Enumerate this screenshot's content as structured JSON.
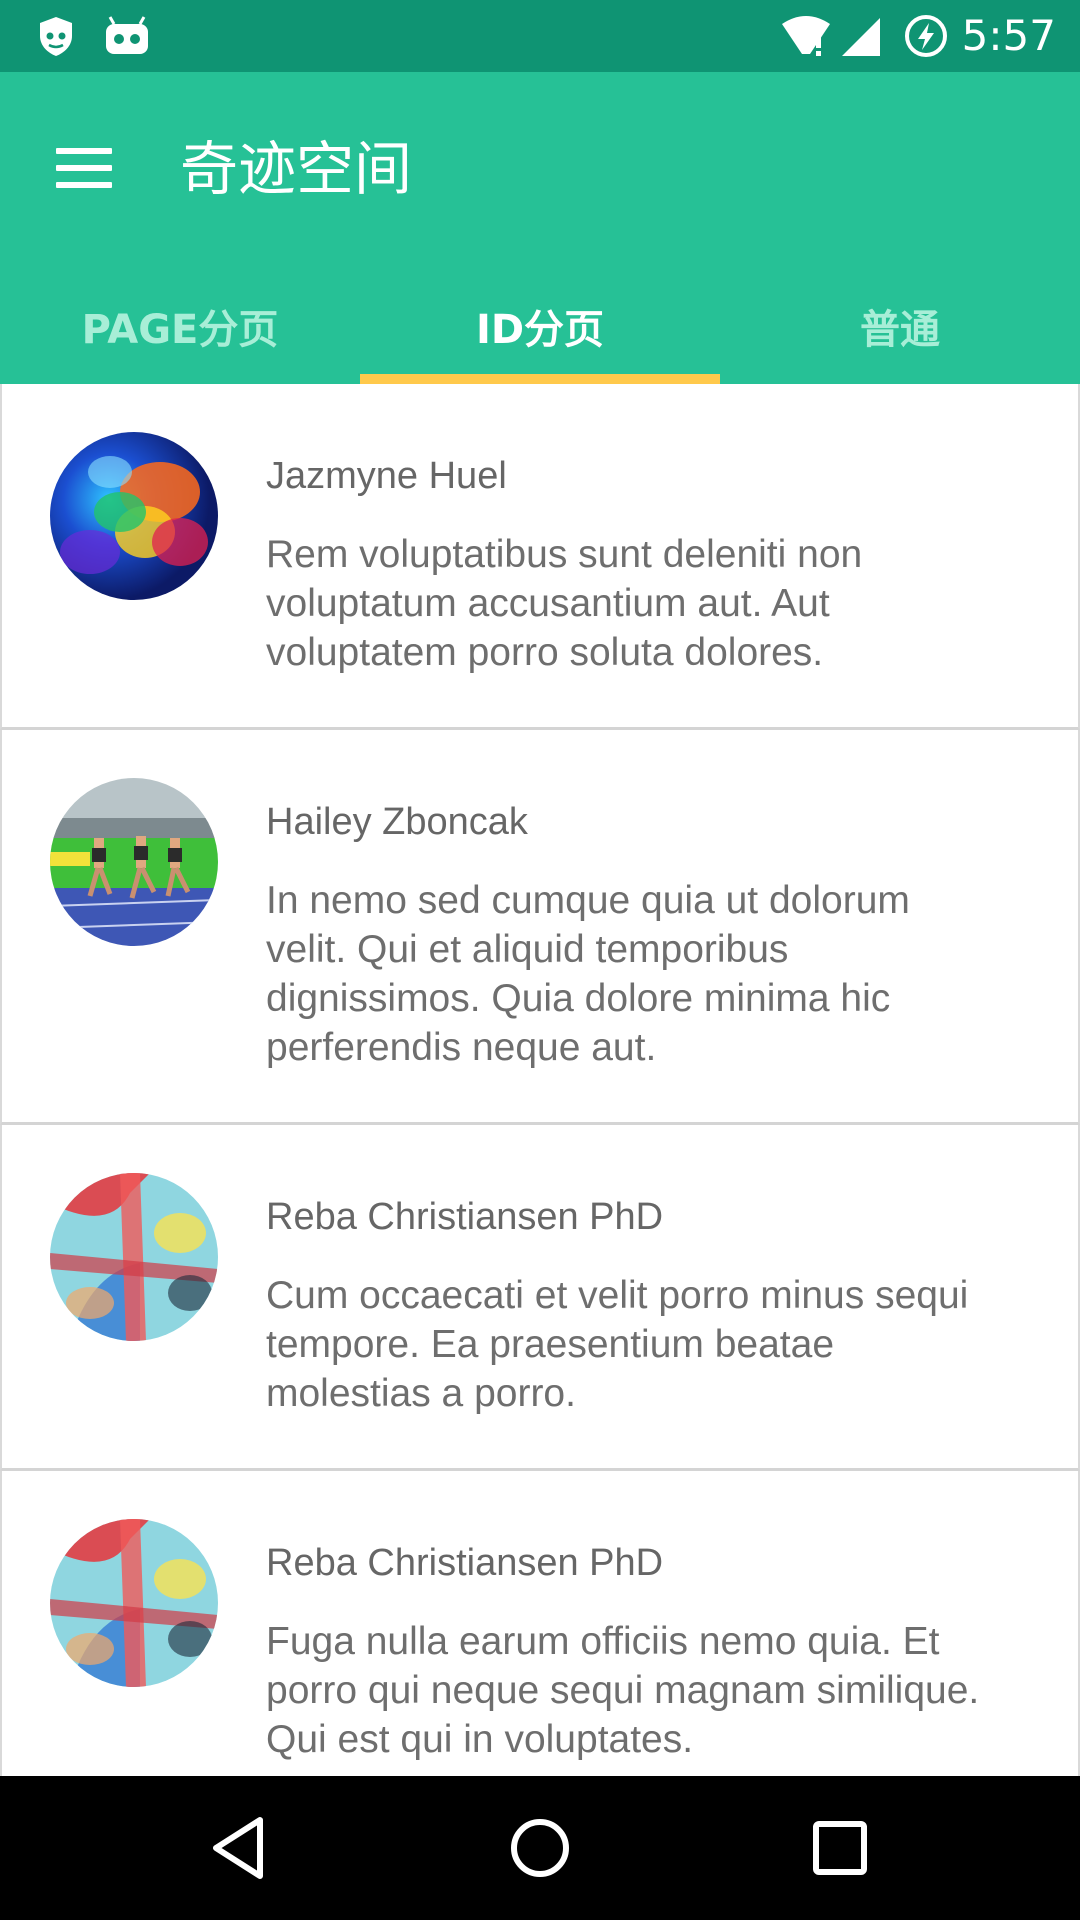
{
  "status_bar": {
    "time": "5:57",
    "icons": [
      "guard-icon",
      "android-debug-icon",
      "wifi-alert-icon",
      "cell-signal-icon",
      "battery-charging-icon"
    ]
  },
  "app_bar": {
    "title": "奇迹空间",
    "menu_icon": "hamburger-menu-icon"
  },
  "tabs": [
    {
      "label": "PAGE分页",
      "active": false
    },
    {
      "label": "ID分页",
      "active": true
    },
    {
      "label": "普通",
      "active": false
    }
  ],
  "list": {
    "items": [
      {
        "name": "Jazmyne Huel",
        "body": "Rem voluptatibus sunt deleniti non voluptatum accusantium aut. Aut voluptatem porro soluta dolores.",
        "avatar": "abstract-color-avatar"
      },
      {
        "name": "Hailey Zboncak",
        "body": "In nemo sed cumque quia ut dolorum velit. Qui et aliquid temporibus dignissimos. Quia dolore minima hic perferendis neque aut.",
        "avatar": "runners-photo-avatar"
      },
      {
        "name": "Reba Christiansen PhD",
        "body": "Cum occaecati et velit porro minus sequi tempore. Ea praesentium beatae molestias a porro.",
        "avatar": "paint-splash-avatar"
      },
      {
        "name": "Reba Christiansen PhD",
        "body": "Fuga nulla earum officiis nemo quia. Et porro qui neque sequi magnam similique. Qui est qui in voluptates.",
        "avatar": "paint-splash-avatar"
      }
    ]
  },
  "nav_bar": {
    "buttons": [
      "back-icon",
      "home-icon",
      "recents-icon"
    ]
  },
  "colors": {
    "status_bar": "#0f9473",
    "primary": "#26c196",
    "tab_indicator": "#ffc94c",
    "tab_inactive_text": "#a8eed7",
    "text_secondary": "#6e6e6e"
  }
}
